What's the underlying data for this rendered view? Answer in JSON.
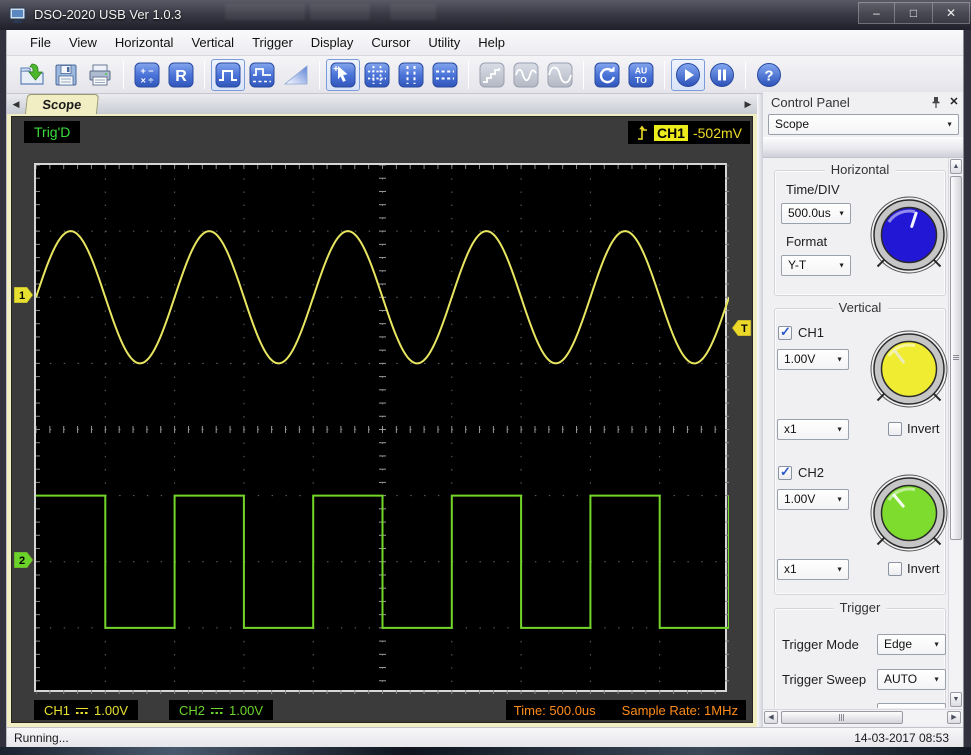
{
  "window": {
    "title": "DSO-2020 USB Ver 1.0.3",
    "controls": {
      "minimize": "–",
      "maximize": "□",
      "close": "✕"
    }
  },
  "menu": {
    "items": [
      "File",
      "View",
      "Horizontal",
      "Vertical",
      "Trigger",
      "Display",
      "Cursor",
      "Utility",
      "Help"
    ]
  },
  "toolbar": {
    "groups": [
      {
        "buttons": [
          {
            "id": "open"
          },
          {
            "id": "save"
          },
          {
            "id": "print"
          }
        ]
      },
      {
        "buttons": [
          {
            "id": "math"
          },
          {
            "id": "reference"
          }
        ]
      },
      {
        "buttons": [
          {
            "id": "pulse",
            "selected": true
          },
          {
            "id": "pulse-train"
          },
          {
            "id": "ramp"
          }
        ]
      },
      {
        "buttons": [
          {
            "id": "cursor",
            "selected": true
          },
          {
            "id": "grid"
          },
          {
            "id": "vertical-cursors"
          },
          {
            "id": "horizontal-cursors"
          }
        ]
      },
      {
        "buttons": [
          {
            "id": "step",
            "disabled": true
          },
          {
            "id": "wave",
            "disabled": true
          },
          {
            "id": "sine",
            "disabled": true
          }
        ]
      },
      {
        "buttons": [
          {
            "id": "refresh"
          },
          {
            "id": "auto"
          }
        ]
      },
      {
        "buttons": [
          {
            "id": "play",
            "selected": true
          },
          {
            "id": "pause"
          }
        ]
      },
      {
        "buttons": [
          {
            "id": "help"
          }
        ]
      }
    ],
    "glyph_text": {
      "reference": "R",
      "math_row1": "+ −",
      "math_row2": "× ÷",
      "auto_row1": "AU",
      "auto_row2": "TO",
      "help": "?"
    }
  },
  "tabs": {
    "active_label": "Scope",
    "left_arrow": "◀",
    "right_arrow": "▶"
  },
  "scope": {
    "header": {
      "status": "Trig'D",
      "trigger_channel": "CH1",
      "trigger_level": "-502mV"
    },
    "markers": {
      "ch1": "1",
      "ch2": "2",
      "trigger": "T"
    },
    "footer": {
      "ch1_label": "CH1",
      "ch1_value": "1.00V",
      "ch2_label": "CH2",
      "ch2_value": "1.00V",
      "time": "Time: 500.0us",
      "sample_rate": "Sample Rate: 1MHz"
    }
  },
  "chart_data": {
    "type": "line",
    "title": "Oscilloscope trace display",
    "divisions": {
      "horizontal": 10,
      "vertical": 8
    },
    "time_per_div": "500.0us",
    "sample_rate": "1MHz",
    "grid": {
      "style": "dotted",
      "subdivisions_per_div": 5
    },
    "series": [
      {
        "name": "CH1",
        "waveform": "sine",
        "color": "#e8e660",
        "volts_per_div": "1.00V",
        "amplitude_div": 1.0,
        "period_div": 2.0,
        "center_offset_div": 2.0,
        "phase": "rising zero-crossing at left edge",
        "frequency": "1kHz"
      },
      {
        "name": "CH2",
        "waveform": "square",
        "color": "#74d629",
        "volts_per_div": "1.00V",
        "amplitude_div": 1.0,
        "period_div": 2.0,
        "center_offset_div": -2.0,
        "duty_cycle": 0.5,
        "starts": "high",
        "frequency": "1kHz"
      }
    ],
    "trigger": {
      "source": "CH1",
      "level": "-502mV",
      "level_div_below_ch1_zero": 0.5,
      "edge": "rising",
      "status": "Trig'D"
    }
  },
  "control_panel": {
    "title": "Control Panel",
    "panel_selector": "Scope",
    "horizontal": {
      "title": "Horizontal",
      "time_div_label": "Time/DIV",
      "time_div_value": "500.0us",
      "format_label": "Format",
      "format_value": "Y-T",
      "knob_color": "#2317d6",
      "knob_pointer_deg": 18
    },
    "vertical": {
      "title": "Vertical",
      "ch1": {
        "label": "CH1",
        "enabled": true,
        "scale": "1.00V",
        "probe": "x1",
        "invert_label": "Invert",
        "invert_checked": false,
        "knob_color": "#f0ec32",
        "knob_pointer_deg": -38
      },
      "ch2": {
        "label": "CH2",
        "enabled": true,
        "scale": "1.00V",
        "probe": "x1",
        "invert_label": "Invert",
        "invert_checked": false,
        "knob_color": "#7edc2e",
        "knob_pointer_deg": -40
      }
    },
    "trigger": {
      "title": "Trigger",
      "mode_label": "Trigger Mode",
      "mode_value": "Edge",
      "sweep_label": "Trigger Sweep",
      "sweep_value": "AUTO"
    }
  },
  "statusbar": {
    "text": "Running...",
    "datetime": "14-03-2017  08:53"
  }
}
